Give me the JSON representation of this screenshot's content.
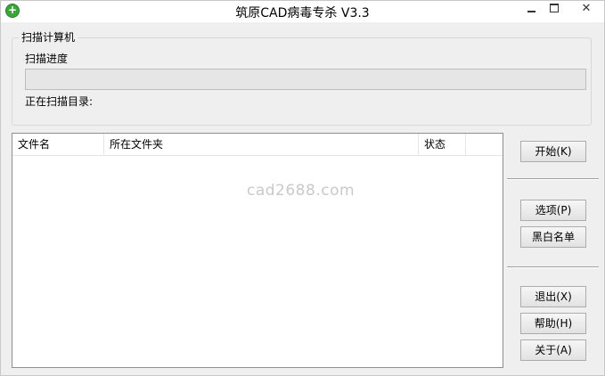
{
  "window": {
    "title": "筑原CAD病毒专杀  V3.3",
    "minimize_label": "",
    "close_label": "✕"
  },
  "scan_group": {
    "legend": "扫描计算机",
    "progress_label": "扫描进度",
    "progress_fraction": 0,
    "dir_label": "正在扫描目录:"
  },
  "list": {
    "columns": [
      "文件名",
      "所在文件夹",
      "状态"
    ],
    "rows": [],
    "watermark": "cad2688.com"
  },
  "buttons": {
    "start": "开始(K)",
    "options": "选项(P)",
    "blackwhite": "黑白名单",
    "exit": "退出(X)",
    "help": "帮助(H)",
    "about": "关于(A)"
  },
  "colors": {
    "app_icon": "#3aa63a",
    "window_bg": "#efefef",
    "progress_fill": "#06b025"
  }
}
